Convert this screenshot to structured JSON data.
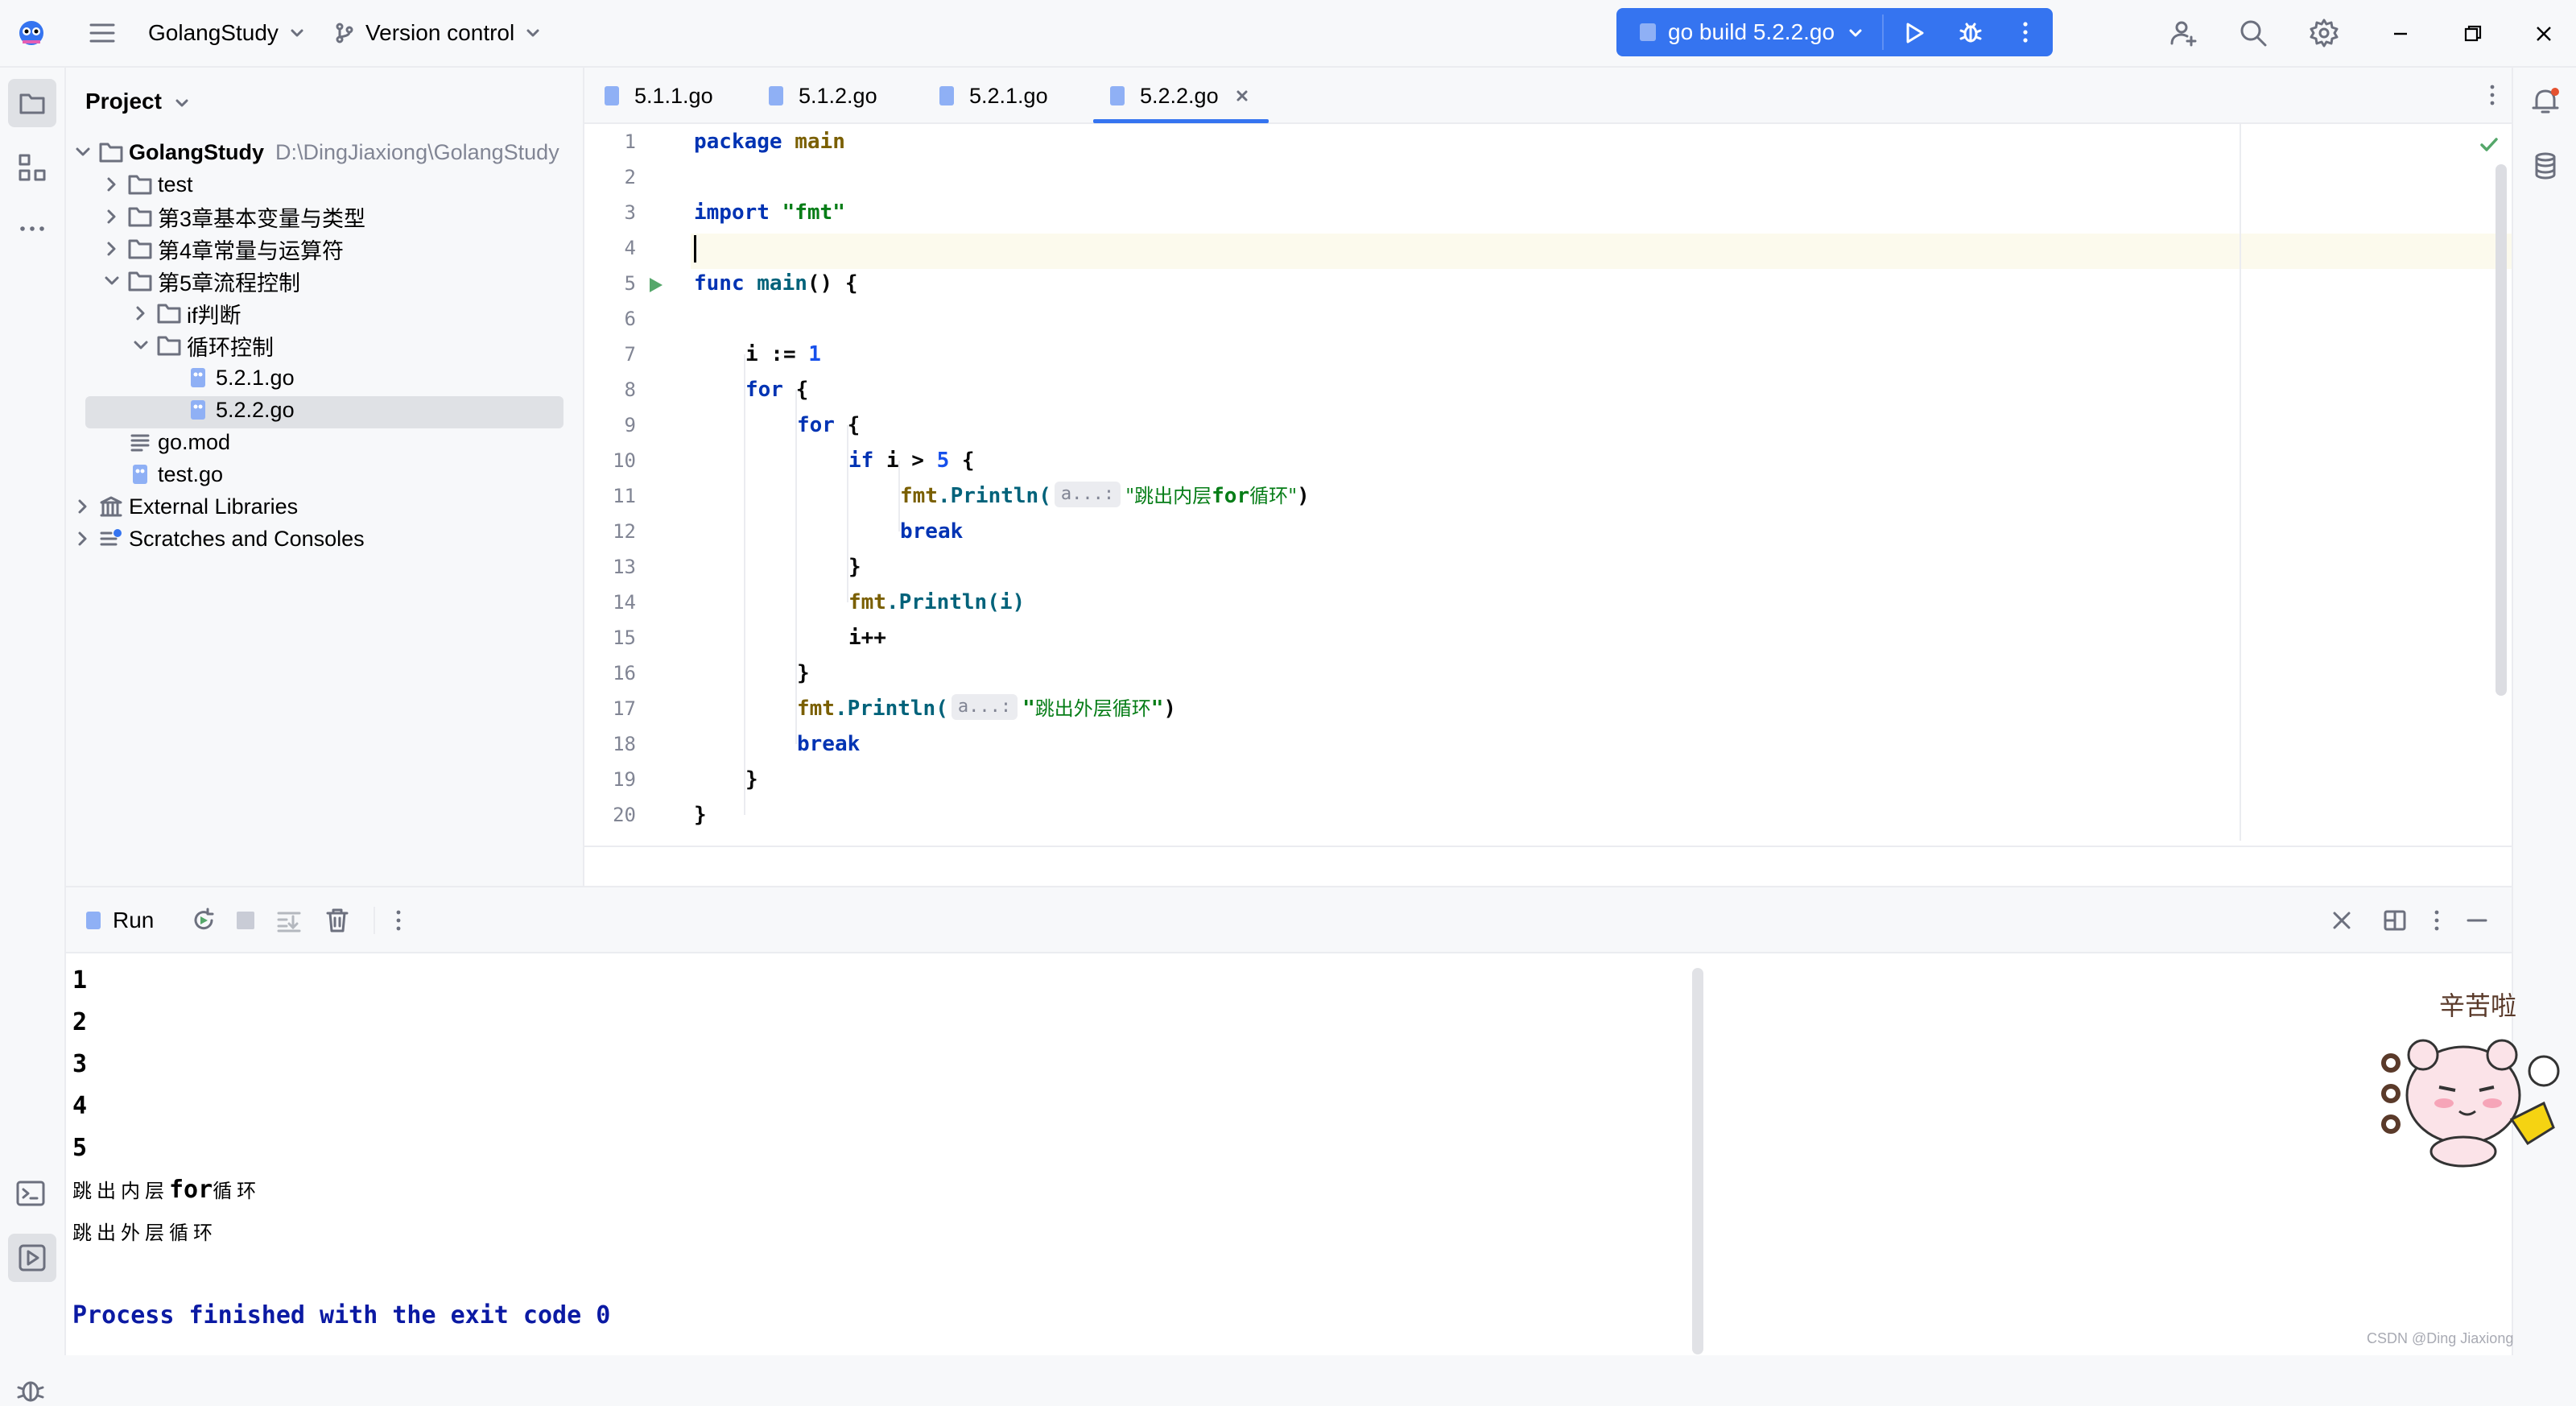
{
  "titlebar": {
    "project_name": "GolangStudy",
    "vcs_label": "Version control",
    "run_config": "go build 5.2.2.go"
  },
  "project_panel": {
    "title": "Project",
    "tree": [
      {
        "label": "GolangStudy",
        "path": "D:\\DingJiaxiong\\GolangStudy",
        "type": "folder",
        "expanded": true,
        "depth": 0
      },
      {
        "label": "test",
        "type": "folder",
        "expanded": false,
        "depth": 1
      },
      {
        "label": "第3章基本变量与类型",
        "type": "folder",
        "expanded": false,
        "depth": 1
      },
      {
        "label": "第4章常量与运算符",
        "type": "folder",
        "expanded": false,
        "depth": 1
      },
      {
        "label": "第5章流程控制",
        "type": "folder",
        "expanded": true,
        "depth": 1
      },
      {
        "label": "if判断",
        "type": "folder",
        "expanded": false,
        "depth": 2
      },
      {
        "label": "循环控制",
        "type": "folder",
        "expanded": true,
        "depth": 2
      },
      {
        "label": "5.2.1.go",
        "type": "gofile",
        "depth": 3
      },
      {
        "label": "5.2.2.go",
        "type": "gofile",
        "depth": 3,
        "selected": true
      },
      {
        "label": "go.mod",
        "type": "modfile",
        "depth": 1
      },
      {
        "label": "test.go",
        "type": "gofile",
        "depth": 1
      },
      {
        "label": "External Libraries",
        "type": "library",
        "expanded": false,
        "depth": 0
      },
      {
        "label": "Scratches and Consoles",
        "type": "scratch",
        "expanded": false,
        "depth": 0
      }
    ]
  },
  "editor": {
    "tabs": [
      {
        "label": "5.1.1.go"
      },
      {
        "label": "5.1.2.go"
      },
      {
        "label": "5.2.1.go"
      },
      {
        "label": "5.2.2.go",
        "active": true
      }
    ],
    "line_numbers": [
      "1",
      "2",
      "3",
      "4",
      "5",
      "6",
      "7",
      "8",
      "9",
      "10",
      "11",
      "12",
      "13",
      "14",
      "15",
      "16",
      "17",
      "18",
      "19",
      "20"
    ],
    "hint_label": "a...:",
    "code": {
      "l1_kw": "package",
      "l1_name": "main",
      "l3_kw": "import",
      "l3_str": "\"fmt\"",
      "l5_kw": "func",
      "l5_fn": "main",
      "l5_rest": "() {",
      "l7_var": "i := ",
      "l7_num": "1",
      "l8_kw": "for",
      "l8_rest": " {",
      "l9_kw": "for",
      "l9_rest": " {",
      "l10_kw": "if",
      "l10_mid": " i > ",
      "l10_num": "5",
      "l10_rest": " {",
      "l11_pkg": "fmt",
      "l11_fn": ".Println(",
      "l11_str_a": "\"跳出内层",
      "l11_str_b": "for",
      "l11_str_c": "循环\"",
      "l11_close": ")",
      "l12_kw": "break",
      "l13": "}",
      "l14_pkg": "fmt",
      "l14_fn": ".Println(i)",
      "l15": "i++",
      "l16": "}",
      "l17_pkg": "fmt",
      "l17_fn": ".Println(",
      "l17_str_a": "\"",
      "l17_str_b": "跳出外层循环",
      "l17_str_c": "\"",
      "l17_close": ")",
      "l18_kw": "break",
      "l19": "}",
      "l20": "}"
    }
  },
  "run_panel": {
    "tab_label": "Run",
    "output_numbers": [
      "1",
      "2",
      "3",
      "4",
      "5"
    ],
    "out_inner_a": "跳出内层",
    "out_inner_b": "for",
    "out_inner_c": "循环",
    "out_outer": "跳出外层循环",
    "exit_message": "Process finished with the exit code 0"
  },
  "sticker_text": "辛苦啦",
  "watermark": "CSDN @Ding Jiaxiong",
  "colors": {
    "accent": "#3574f0",
    "keyword": "#0033b3",
    "string": "#067d17",
    "number": "#1750eb",
    "package": "#7a5f00",
    "function": "#00627a",
    "exit_text": "#0b1aa3",
    "run_green": "#55a76a"
  }
}
